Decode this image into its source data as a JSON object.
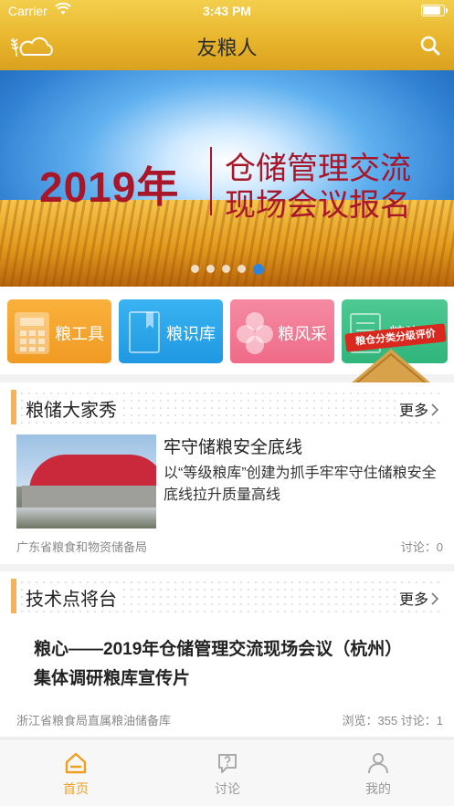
{
  "status_bar": {
    "carrier": "Carrier",
    "time": "3:43 PM"
  },
  "nav": {
    "title": "友粮人",
    "logo_icon": "wheat-cloud-logo-icon",
    "search_icon": "search-icon"
  },
  "banner": {
    "year_text": "2019年",
    "line1": "仓储管理交流",
    "line2": "现场会议报名",
    "slide_count": 5,
    "active_slide": 5
  },
  "tiles": [
    {
      "label": "粮工具",
      "icon": "calculator-icon",
      "color": "#f4a62e"
    },
    {
      "label": "粮识库",
      "icon": "book-icon",
      "color": "#2ba6ea"
    },
    {
      "label": "粮风采",
      "icon": "flower-icon",
      "color": "#f27b95"
    },
    {
      "label": "粮资讯",
      "icon": "news-icon",
      "color": "#3dbf86"
    }
  ],
  "badge": {
    "ribbon": "粮仓分类分级评价"
  },
  "section1": {
    "title": "粮储大家秀",
    "more": "更多",
    "item": {
      "title": "牢守储粮安全底线",
      "desc": "以“等级粮库”创建为抓手牢牢守住储粮安全底线拉升质量高线",
      "source": "广东省粮食和物资储备局",
      "meta": "讨论：0"
    }
  },
  "section2": {
    "title": "技术点将台",
    "more": "更多",
    "item": {
      "title": "粮心——2019年仓储管理交流现场会议（杭州）集体调研粮库宣传片",
      "source": "浙江省粮食局直属粮油储备库",
      "meta": "浏览：355  讨论：1"
    }
  },
  "tabbar": [
    {
      "label": "首页",
      "icon": "home-icon",
      "active": true
    },
    {
      "label": "讨论",
      "icon": "question-bubble-icon",
      "active": false
    },
    {
      "label": "我的",
      "icon": "user-icon",
      "active": false
    }
  ],
  "colors": {
    "accent": "#f0a020",
    "nav_gold": "#e9b62d",
    "banner_red": "#a8162a"
  }
}
